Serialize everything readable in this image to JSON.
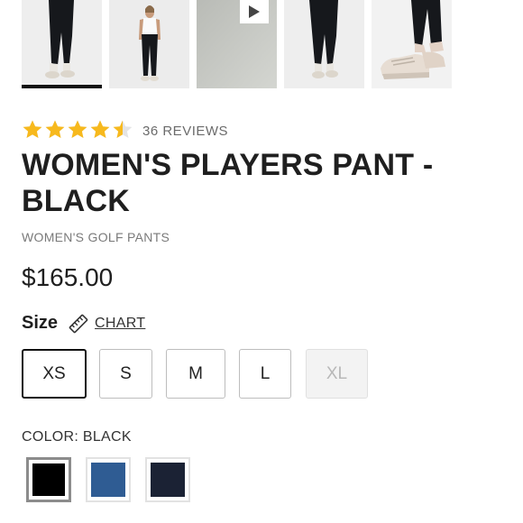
{
  "gallery": {
    "selected_index": 0,
    "thumbnails": [
      {
        "name": "product-image-1",
        "bg": "#eeeeee"
      },
      {
        "name": "product-image-2",
        "bg": "#ececec"
      },
      {
        "name": "product-video",
        "bg": "#c9cbc7",
        "icon": "play-icon"
      },
      {
        "name": "product-image-4",
        "bg": "#eeeeee"
      },
      {
        "name": "product-image-5",
        "bg": "#f2f2f2"
      }
    ]
  },
  "rating": {
    "value": 4.5,
    "max": 5,
    "star_color": "#f7b91d",
    "reviews_text": "36 REVIEWS"
  },
  "product": {
    "title": "WOMEN'S PLAYERS PANT - BLACK",
    "category": "WOMEN'S GOLF PANTS",
    "price": "$165.00"
  },
  "size": {
    "label": "Size",
    "chart_link": "CHART",
    "options": [
      {
        "label": "XS",
        "state": "selected"
      },
      {
        "label": "S",
        "state": "available"
      },
      {
        "label": "M",
        "state": "available"
      },
      {
        "label": "L",
        "state": "available"
      },
      {
        "label": "XL",
        "state": "disabled"
      }
    ]
  },
  "color": {
    "label": "COLOR: BLACK",
    "swatches": [
      {
        "name": "black",
        "hex": "#000000",
        "selected": true
      },
      {
        "name": "blue",
        "hex": "#2f5c93",
        "selected": false
      },
      {
        "name": "navy",
        "hex": "#1b2234",
        "selected": false
      }
    ]
  }
}
